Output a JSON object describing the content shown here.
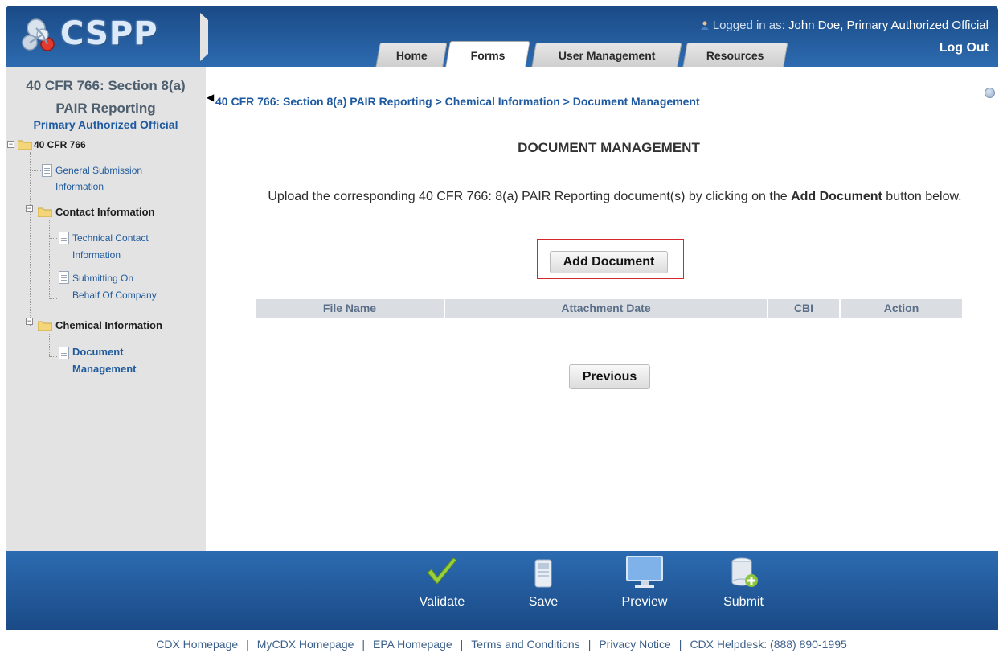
{
  "header": {
    "app_name": "CSPP",
    "logged_in_prefix": "Logged in as: ",
    "logged_in_user": "John Doe, Primary Authorized Official",
    "logout_label": "Log Out",
    "tabs": [
      {
        "label": "Home"
      },
      {
        "label": "Forms"
      },
      {
        "label": "User Management"
      },
      {
        "label": "Resources"
      }
    ],
    "active_tab": "Forms"
  },
  "sidebar": {
    "title_line1": "40 CFR 766: Section 8(a)",
    "title_line2": "PAIR Reporting",
    "role": "Primary Authorized Official",
    "tree": {
      "root": "40 CFR 766",
      "general_1": "General Submission",
      "general_2": "Information",
      "contact": "Contact Information",
      "tech_1": "Technical Contact",
      "tech_2": "Information",
      "behalf_1": "Submitting On",
      "behalf_2": "Behalf Of Company",
      "chemical": "Chemical Information",
      "docmgmt_1": "Document",
      "docmgmt_2": "Management"
    }
  },
  "main": {
    "breadcrumb": "40 CFR 766: Section 8(a) PAIR Reporting > Chemical Information > Document Management",
    "heading": "DOCUMENT MANAGEMENT",
    "instructions_part1": "Upload the corresponding 40 CFR 766: 8(a) PAIR Reporting document(s) by clicking on the ",
    "instructions_bold": "Add Document",
    "instructions_part2": " button below.",
    "add_document_label": "Add Document",
    "previous_label": "Previous",
    "table_headers": [
      "File Name",
      "Attachment Date",
      "CBI",
      "Action"
    ]
  },
  "toolbar": {
    "validate": "Validate",
    "save": "Save",
    "preview": "Preview",
    "submit": "Submit"
  },
  "footer": {
    "links": [
      "CDX Homepage",
      "MyCDX Homepage",
      "EPA Homepage",
      "Terms and Conditions",
      "Privacy Notice",
      "CDX Helpdesk: (888) 890-1995"
    ]
  },
  "colors": {
    "header_blue": "#1a4a86",
    "link_blue": "#1e5aa0",
    "highlight_red": "#d6262b"
  }
}
